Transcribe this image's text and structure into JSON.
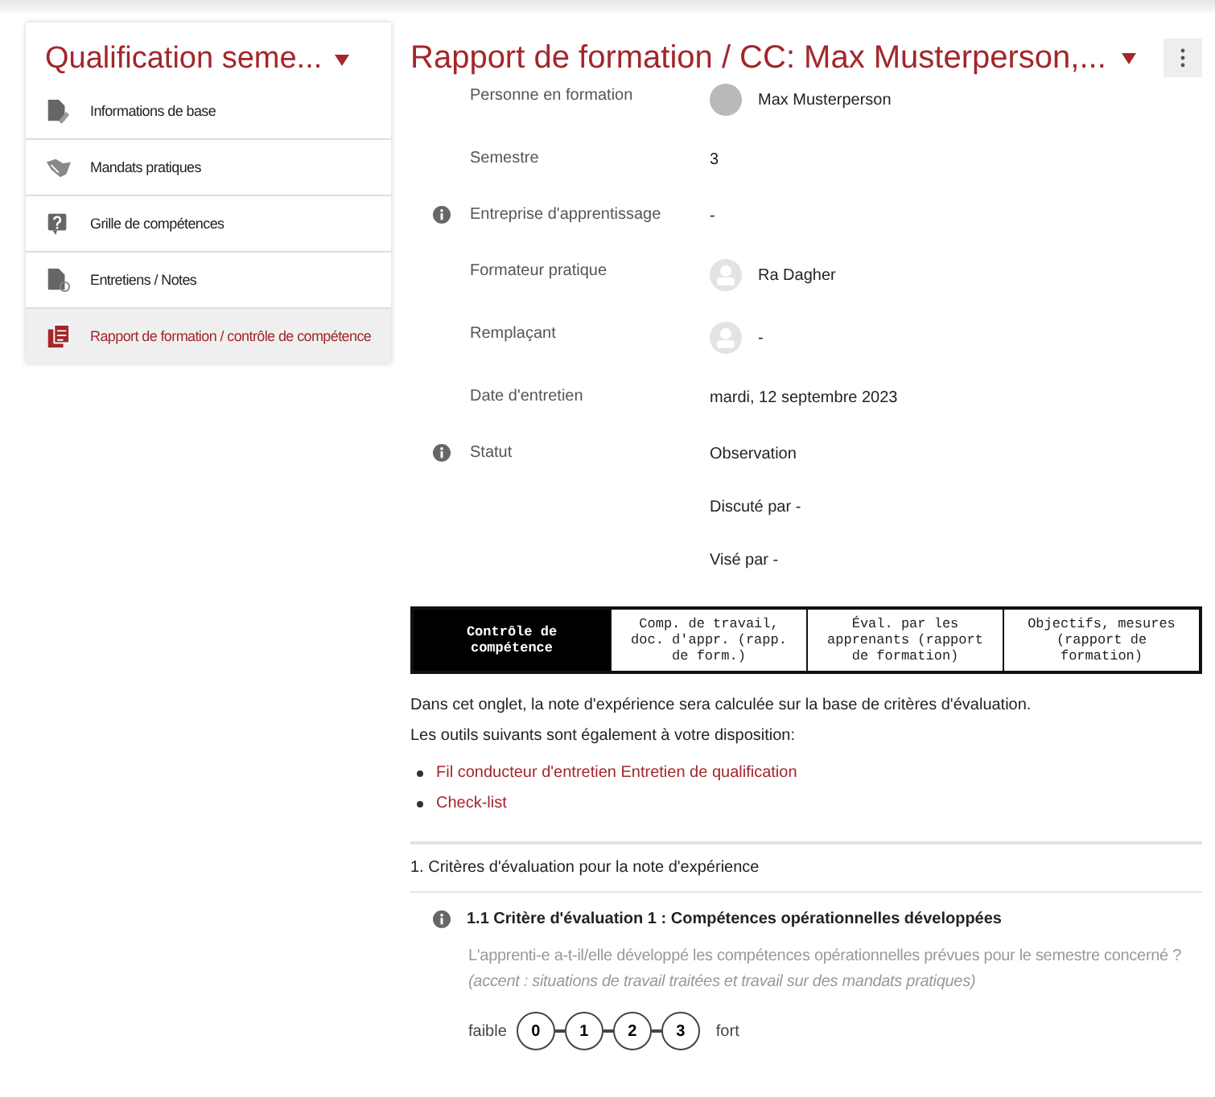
{
  "sidebar": {
    "title": "Qualification seme...",
    "items": [
      {
        "label": "Informations de base",
        "kind": "document",
        "selected": false
      },
      {
        "label": "Mandats pratiques",
        "kind": "handshake",
        "selected": false
      },
      {
        "label": "Grille de compétences",
        "kind": "question",
        "selected": false
      },
      {
        "label": "Entretiens / Notes",
        "kind": "document-e",
        "selected": false
      },
      {
        "label": "Rapport de formation / contrôle de compétence",
        "kind": "report",
        "selected": true
      }
    ]
  },
  "main": {
    "title": "Rapport de formation / CC: Max Musterperson,...",
    "fields": [
      {
        "label": "Personne en formation",
        "lines": [
          "Max Musterperson"
        ],
        "info": false,
        "kind": "person-photo"
      },
      {
        "label": "Semestre",
        "lines": [
          "3"
        ],
        "info": false,
        "kind": "plain"
      },
      {
        "label": "Entreprise d'apprentissage",
        "lines": [
          "-"
        ],
        "info": true,
        "kind": "plain"
      },
      {
        "label": "Formateur pratique",
        "lines": [
          "Ra Dagher"
        ],
        "info": false,
        "kind": "person"
      },
      {
        "label": "Remplaçant",
        "lines": [
          "-"
        ],
        "info": false,
        "kind": "person"
      },
      {
        "label": "Date d'entretien",
        "lines": [
          "mardi, 12 septembre 2023"
        ],
        "info": false,
        "kind": "plain"
      },
      {
        "label": "Statut",
        "lines": [
          "Observation",
          "Discuté par -",
          "Visé par -"
        ],
        "info": true,
        "kind": "plain"
      }
    ],
    "tabs": [
      {
        "label": "Contrôle de compétence",
        "selected": true
      },
      {
        "label": "Comp. de travail, doc. d'appr. (rapp. de form.)",
        "selected": false
      },
      {
        "label": "Éval. par les apprenants (rapport de formation)",
        "selected": false
      },
      {
        "label": "Objectifs, mesures (rapport de formation)",
        "selected": false
      }
    ],
    "intro": [
      "Dans cet onglet, la note d'expérience sera calculée sur la base de critères d'évaluation.",
      "Les outils suivants sont également à votre disposition:"
    ],
    "links": [
      "Fil conducteur d'entretien Entretien de qualification",
      "Check-list"
    ],
    "section": "1. Critères d'évaluation pour la note d'expérience",
    "criterion": {
      "title": "1.1 Critère d'évaluation 1 : Compétences opérationnelles développées",
      "question": "L'apprenti-e a-t-il/elle développé les compétences opérationnelles prévues pour le semestre concerné ?",
      "hint": "(accent : situations de travail traitées et travail sur des mandats pratiques)",
      "low": "faible",
      "high": "fort",
      "scale": [
        {
          "label": "0",
          "selected": false
        },
        {
          "label": "1",
          "selected": false
        },
        {
          "label": "2",
          "selected": false
        },
        {
          "label": "3",
          "selected": false
        }
      ]
    }
  }
}
